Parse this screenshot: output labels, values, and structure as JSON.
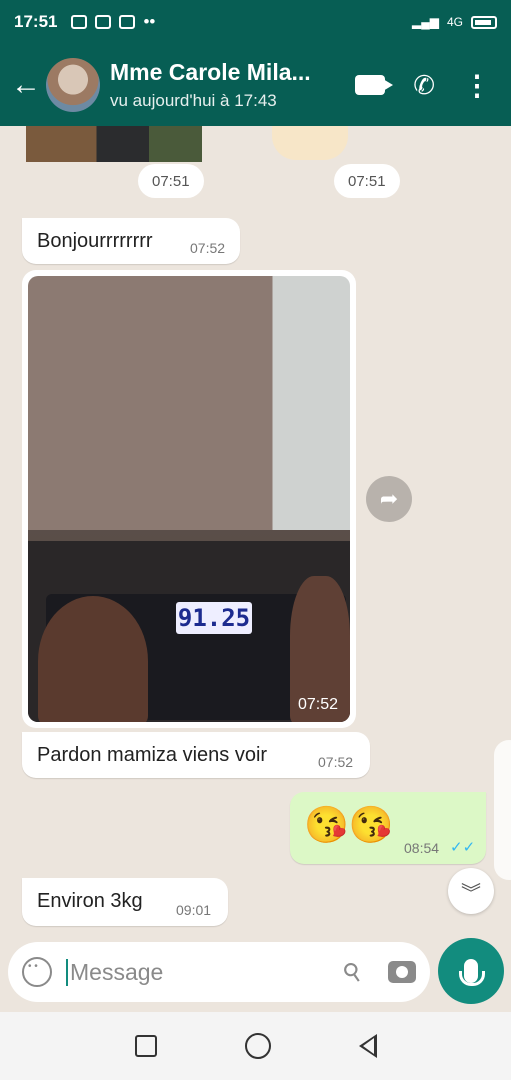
{
  "status_bar": {
    "time": "17:51",
    "notifications": [
      "game-icon",
      "at-icon",
      "facebook-icon",
      "more-dots"
    ],
    "signal": "4G"
  },
  "header": {
    "contact_name": "Mme Carole Mila...",
    "last_seen": "vu aujourd'hui à 17:43"
  },
  "messages": [
    {
      "type": "time-chip",
      "time": "07:51"
    },
    {
      "type": "time-chip",
      "time": "07:51"
    },
    {
      "type": "text",
      "direction": "in",
      "text": "Bonjourrrrrrrr",
      "time": "07:52"
    },
    {
      "type": "image",
      "direction": "in",
      "time": "07:52",
      "scale_reading": "91.25"
    },
    {
      "type": "text",
      "direction": "in",
      "text": "Pardon mamiza viens voir",
      "time": "07:52"
    },
    {
      "type": "emoji",
      "direction": "out",
      "emoji": "😘😘",
      "time": "08:54",
      "status": "read"
    },
    {
      "type": "text",
      "direction": "in",
      "text": "Environ 3kg",
      "time": "09:01"
    }
  ],
  "input": {
    "placeholder": "Message"
  },
  "colors": {
    "header": "#075e54",
    "accent": "#128c7e",
    "outgoing_bubble": "#dcf8c6",
    "background": "#ece5dd",
    "read_ticks": "#34b7f1"
  }
}
